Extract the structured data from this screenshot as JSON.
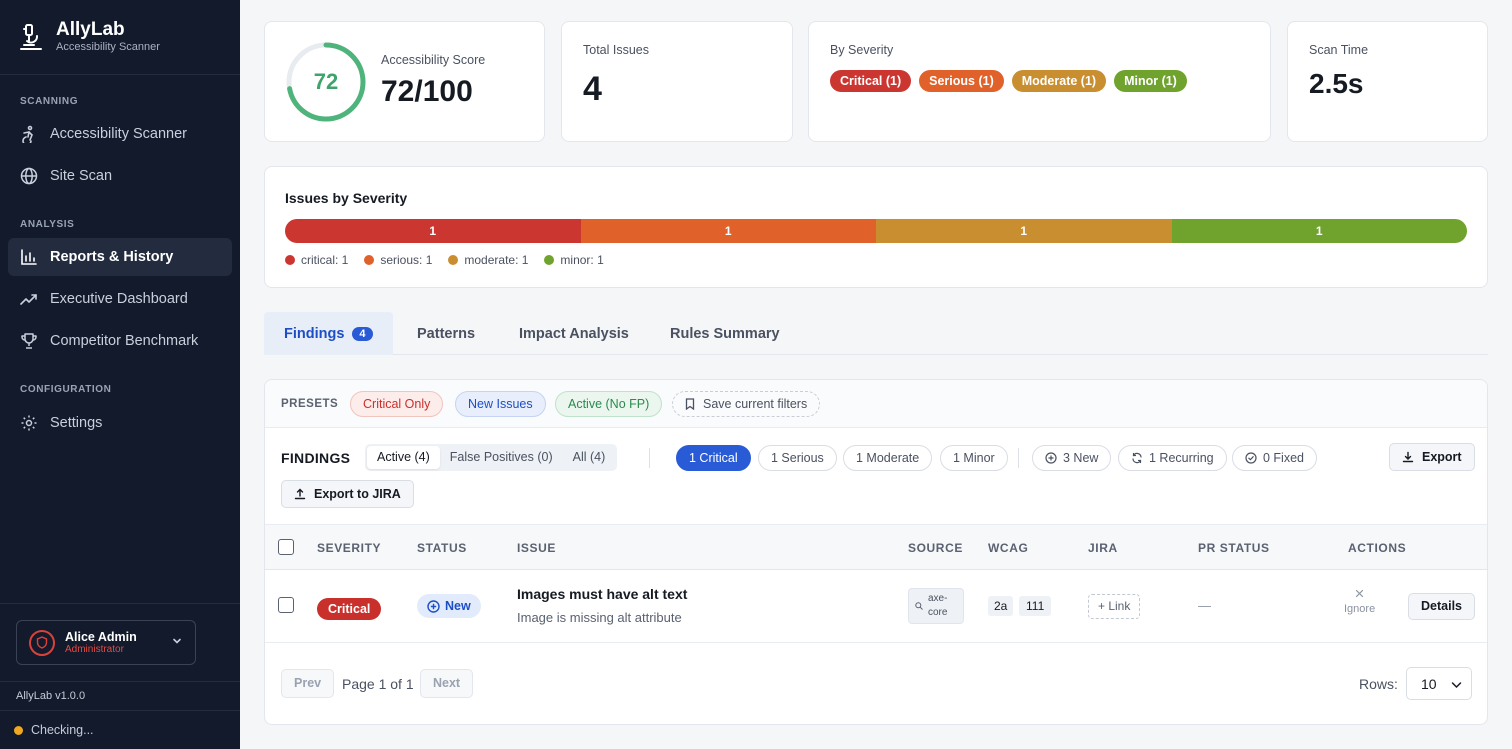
{
  "brand": {
    "title": "AllyLab",
    "subtitle": "Accessibility Scanner"
  },
  "sidebar": {
    "sections": [
      "SCANNING",
      "ANALYSIS",
      "CONFIGURATION"
    ],
    "items": [
      {
        "label": "Accessibility Scanner",
        "icon": "accessibility-icon"
      },
      {
        "label": "Site Scan",
        "icon": "globe-icon"
      },
      {
        "label": "Reports & History",
        "icon": "bar-chart-icon",
        "active": true
      },
      {
        "label": "Executive Dashboard",
        "icon": "trending-up-icon"
      },
      {
        "label": "Competitor Benchmark",
        "icon": "trophy-icon"
      },
      {
        "label": "Settings",
        "icon": "gear-icon"
      }
    ],
    "user": {
      "name": "Alice Admin",
      "role": "Administrator"
    },
    "version": "AllyLab v1.0.0",
    "status": "Checking..."
  },
  "stats": {
    "score": {
      "label": "Accessibility Score",
      "value": "72",
      "display": "72/100",
      "fraction": 0.72
    },
    "total": {
      "label": "Total Issues",
      "value": "4"
    },
    "severity": {
      "label": "By Severity",
      "pills": [
        "Critical (1)",
        "Serious (1)",
        "Moderate (1)",
        "Minor (1)"
      ]
    },
    "scan_time": {
      "label": "Scan Time",
      "value": "2.5s"
    }
  },
  "issues_by_severity": {
    "title": "Issues by Severity",
    "segments": [
      "1",
      "1",
      "1",
      "1"
    ],
    "legend": [
      "critical: 1",
      "serious: 1",
      "moderate: 1",
      "minor: 1"
    ],
    "colors": {
      "critical": "#cc3631",
      "serious": "#e0622a",
      "moderate": "#c98e30",
      "minor": "#6fa32e"
    }
  },
  "tabs": [
    {
      "label": "Findings",
      "count": "4",
      "active": true
    },
    {
      "label": "Patterns"
    },
    {
      "label": "Impact Analysis"
    },
    {
      "label": "Rules Summary"
    }
  ],
  "presets": {
    "label": "PRESETS",
    "items": [
      "Critical Only",
      "New Issues",
      "Active (No FP)",
      "Save current filters"
    ]
  },
  "findings": {
    "label": "FINDINGS",
    "segments": [
      "Active (4)",
      "False Positives (0)",
      "All (4)"
    ],
    "chips": [
      "1 Critical",
      "1 Serious",
      "1 Moderate",
      "1 Minor",
      "3 New",
      "1 Recurring",
      "0 Fixed"
    ],
    "export": "Export",
    "export_jira": "Export to JIRA"
  },
  "table": {
    "headers": [
      "SEVERITY",
      "STATUS",
      "ISSUE",
      "SOURCE",
      "WCAG",
      "JIRA",
      "PR STATUS",
      "ACTIONS"
    ],
    "rows": [
      {
        "severity": "Critical",
        "status": "New",
        "title": "Images must have alt text",
        "description": "Image is missing alt attribute",
        "source_line1": "axe-",
        "source_line2": "core",
        "wcag": [
          "2a",
          "111"
        ],
        "jira": "+ Link",
        "pr_status": "—",
        "ignore": "Ignore",
        "details": "Details"
      }
    ]
  },
  "pagination": {
    "prev": "Prev",
    "info": "Page 1 of 1",
    "next": "Next",
    "rows_label": "Rows:",
    "rows_value": "10"
  }
}
